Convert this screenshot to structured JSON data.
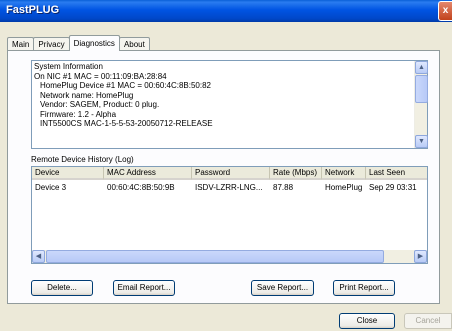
{
  "window": {
    "title": "FastPLUG",
    "close_glyph": "x",
    "close_icon": "close-icon"
  },
  "tabs": [
    {
      "label": "Main"
    },
    {
      "label": "Privacy"
    },
    {
      "label": "Diagnostics",
      "active": true
    },
    {
      "label": "About"
    }
  ],
  "system_info": {
    "label": "System Information",
    "lines": [
      "On NIC #1 MAC = 00:11:09:BA:28:84",
      "HomePlug Device #1 MAC = 00:60:4C:8B:50:82",
      "Network name: HomePlug",
      "Vendor: SAGEM, Product: 0 plug.",
      "Firmware: 1.2 - Alpha",
      "INT5500CS MAC-1-5-5-53-20050712-RELEASE"
    ]
  },
  "history": {
    "label": "Remote Device History (Log)",
    "columns": [
      "Device",
      "MAC Address",
      "Password",
      "Rate (Mbps)",
      "Network",
      "Last Seen"
    ],
    "rows": [
      [
        "Device 3",
        "00:60:4C:8B:50:9B",
        "ISDV-LZRR-LNG...",
        "87.88",
        "HomePlug",
        "Sep 29 03:31"
      ]
    ]
  },
  "scroll_glyphs": {
    "up": "▲",
    "down": "▼",
    "left": "◀",
    "right": "▶"
  },
  "buttons": {
    "delete": "Delete...",
    "email": "Email Report...",
    "save": "Save Report...",
    "print": "Print Report...",
    "close": "Close",
    "cancel": "Cancel"
  }
}
